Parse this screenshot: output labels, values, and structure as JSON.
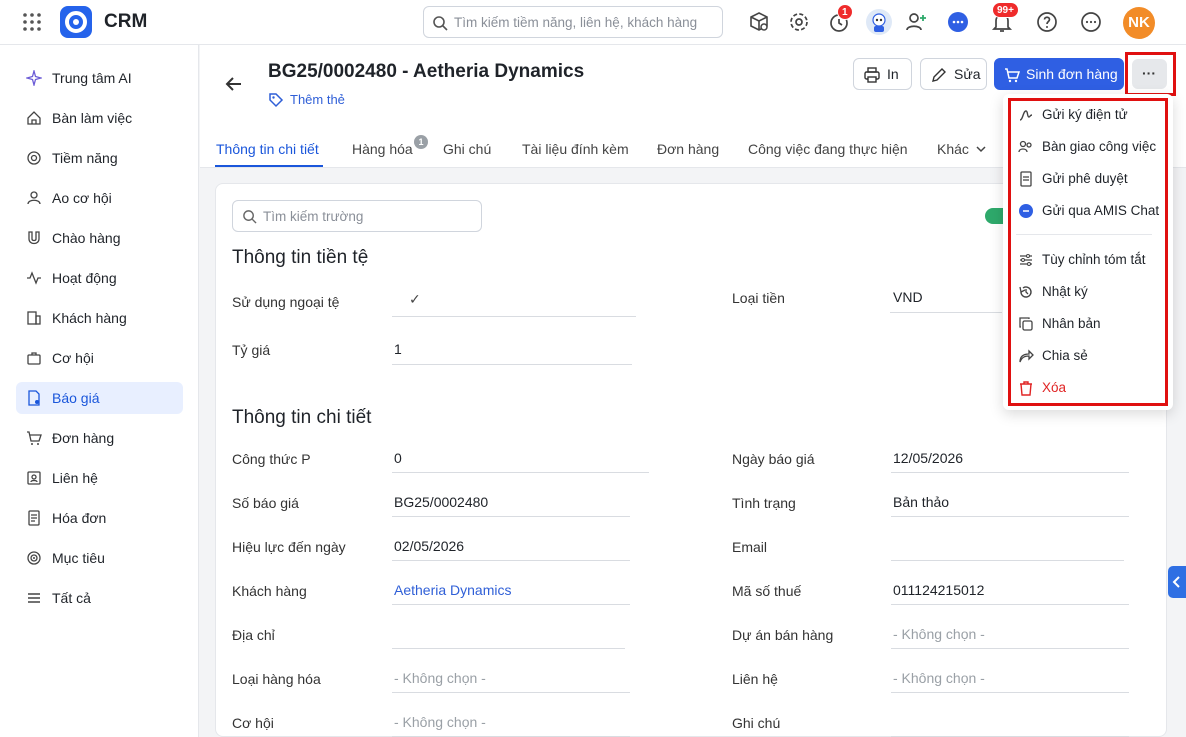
{
  "app": {
    "brand": "CRM"
  },
  "topbar": {
    "search_placeholder": "Tìm kiếm tiềm năng, liên hệ, khách hàng",
    "reminder_badge": "1",
    "notification_badge": "99+",
    "avatar_initials": "NK"
  },
  "sidebar": {
    "items": [
      {
        "label": "Trung tâm AI",
        "icon": "sparkle-icon"
      },
      {
        "label": "Bàn làm việc",
        "icon": "home-icon"
      },
      {
        "label": "Tiềm năng",
        "icon": "target-icon"
      },
      {
        "label": "Ao cơ hội",
        "icon": "opportunity-pool-icon"
      },
      {
        "label": "Chào hàng",
        "icon": "magnet-icon"
      },
      {
        "label": "Hoạt động",
        "icon": "activity-icon"
      },
      {
        "label": "Khách hàng",
        "icon": "building-icon"
      },
      {
        "label": "Cơ hội",
        "icon": "briefcase-icon"
      },
      {
        "label": "Báo giá",
        "icon": "quote-doc-icon"
      },
      {
        "label": "Đơn hàng",
        "icon": "cart-icon"
      },
      {
        "label": "Liên hệ",
        "icon": "contact-card-icon"
      },
      {
        "label": "Hóa đơn",
        "icon": "invoice-icon"
      },
      {
        "label": "Mục tiêu",
        "icon": "goal-icon"
      },
      {
        "label": "Tất cả",
        "icon": "menu-lines-icon"
      }
    ],
    "active": "Báo giá"
  },
  "header": {
    "title": "BG25/0002480 - Aetheria Dynamics",
    "add_tag": "Thêm thẻ",
    "print_label": "In",
    "edit_label": "Sửa",
    "create_order_label": "Sinh đơn hàng",
    "more_label": "···"
  },
  "tabs": [
    {
      "label": "Thông tin chi tiết",
      "active": true
    },
    {
      "label": "Hàng hóa",
      "badge": "1"
    },
    {
      "label": "Ghi chú"
    },
    {
      "label": "Tài liệu đính kèm"
    },
    {
      "label": "Đơn hàng"
    },
    {
      "label": "Công việc đang thực hiện"
    },
    {
      "label": "Khác"
    }
  ],
  "content": {
    "field_search_placeholder": "Tìm kiếm trường",
    "currency_section": {
      "title": "Thông tin tiền tệ",
      "use_foreign_label": "Sử dụng ngoại tệ",
      "use_foreign_value": "✓",
      "currency_type_label": "Loại tiền",
      "currency_type_value": "VND",
      "rate_label": "Tỷ giá",
      "rate_value": "1"
    },
    "detail_section": {
      "title": "Thông tin chi tiết",
      "formula_label": "Công thức P",
      "formula_value": "0",
      "quote_date_label": "Ngày báo giá",
      "quote_date_value": "12/05/2026",
      "quote_no_label": "Số báo giá",
      "quote_no_value": "BG25/0002480",
      "status_label": "Tình trạng",
      "status_value": "Bản thảo",
      "valid_until_label": "Hiệu lực đến ngày",
      "valid_until_value": "02/05/2026",
      "email_label": "Email",
      "email_value": "",
      "customer_label": "Khách hàng",
      "customer_value": "Aetheria Dynamics",
      "tax_label": "Mã số thuế",
      "tax_value": "011124215012",
      "address_label": "Địa chỉ",
      "address_value": "",
      "project_label": "Dự án bán hàng",
      "project_value": "- Không chọn -",
      "product_type_label": "Loại hàng hóa",
      "product_type_value": "- Không chọn -",
      "contact_label": "Liên hệ",
      "contact_value": "- Không chọn -",
      "opportunity_label": "Cơ hội",
      "opportunity_value": "- Không chọn -",
      "note_label": "Ghi chú",
      "note_value": ""
    }
  },
  "more_menu": {
    "items": [
      {
        "label": "Gửi ký điện tử",
        "icon": "e-sign-icon"
      },
      {
        "label": "Bàn giao công việc",
        "icon": "handover-icon"
      },
      {
        "label": "Gửi phê duyệt",
        "icon": "approval-doc-icon"
      },
      {
        "label": "Gửi qua AMIS Chat",
        "icon": "amis-chat-icon"
      },
      {
        "label": "Tùy chỉnh tóm tắt",
        "icon": "sliders-icon"
      },
      {
        "label": "Nhật ký",
        "icon": "history-icon"
      },
      {
        "label": "Nhân bản",
        "icon": "duplicate-icon"
      },
      {
        "label": "Chia sẻ",
        "icon": "share-icon"
      },
      {
        "label": "Xóa",
        "icon": "trash-icon",
        "danger": true
      }
    ]
  },
  "colors": {
    "accent": "#2f5fe3",
    "danger": "#e02424",
    "highlight": "#e01010"
  }
}
